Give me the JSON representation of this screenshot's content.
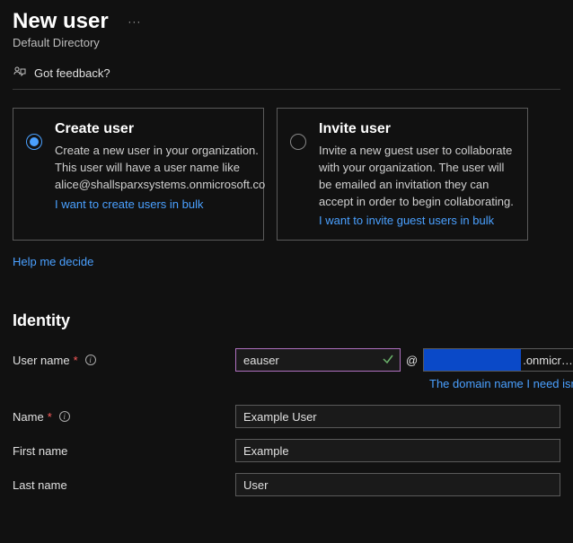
{
  "header": {
    "title": "New user",
    "subtitle": "Default Directory",
    "ellipsis": "···",
    "feedback": "Got feedback?"
  },
  "cards": {
    "create": {
      "title": "Create user",
      "desc": "Create a new user in your organization. This user will have a user name like alice@shallsparxsystems.onmicrosoft.co",
      "bulk_link": "I want to create users in bulk"
    },
    "invite": {
      "title": "Invite user",
      "desc": "Invite a new guest user to collaborate with your organization. The user will be emailed an invitation they can accept in order to begin collaborating.",
      "bulk_link": "I want to invite guest users in bulk"
    },
    "help_link": "Help me decide"
  },
  "identity": {
    "section_title": "Identity",
    "username_label": "User name",
    "username_value": "eauser",
    "at": "@",
    "domain_suffix": ".onmicr…",
    "domain_hint": "The domain name I need isn't",
    "name_label": "Name",
    "name_value": "Example User",
    "firstname_label": "First name",
    "firstname_value": "Example",
    "lastname_label": "Last name",
    "lastname_value": "User"
  }
}
